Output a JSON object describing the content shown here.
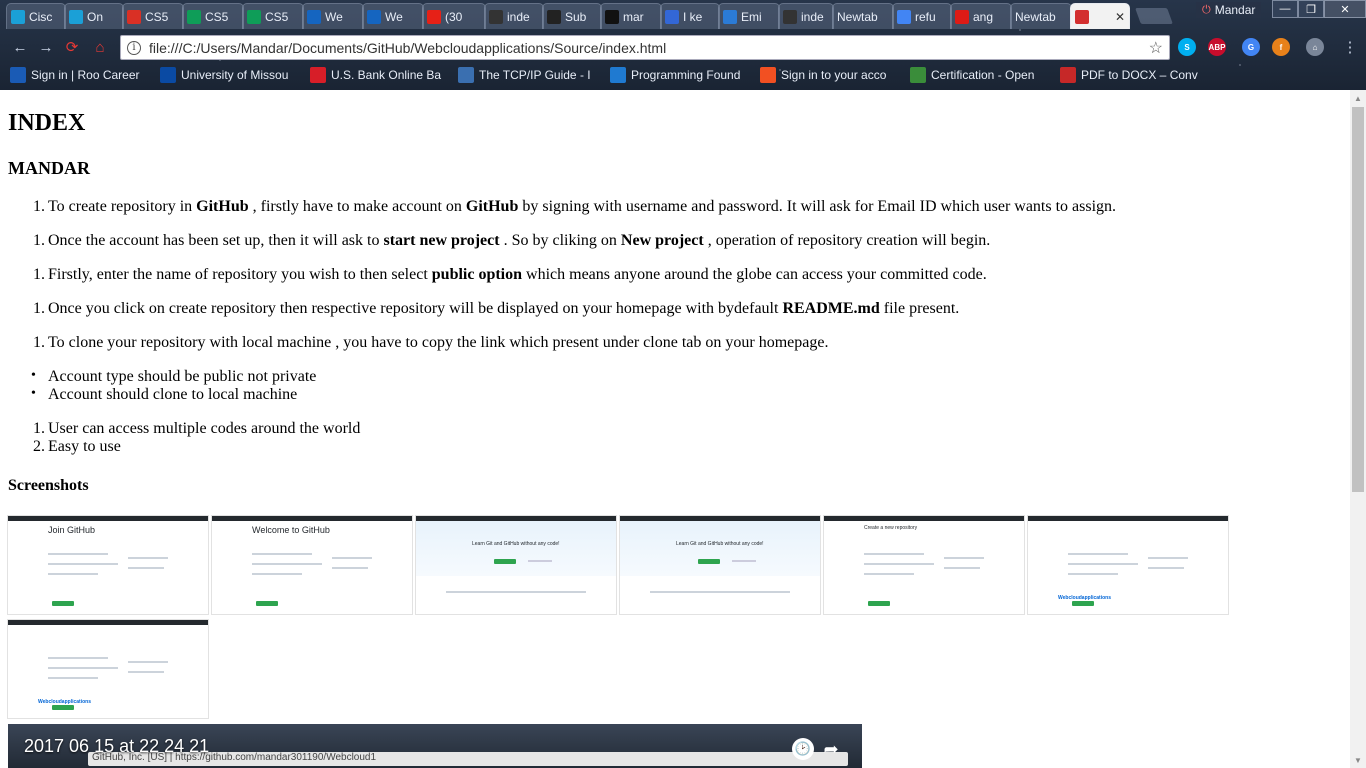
{
  "tabs": [
    {
      "label": "Cisc",
      "icon": "cisco-icon",
      "color": "#1ba0d7"
    },
    {
      "label": "On",
      "icon": "cisco-icon",
      "color": "#1ba0d7"
    },
    {
      "label": "CS5",
      "icon": "gmail-icon",
      "color": "#d93025"
    },
    {
      "label": "CS5",
      "icon": "sheets-icon",
      "color": "#0f9d58"
    },
    {
      "label": "CS5",
      "icon": "sheets-icon",
      "color": "#0f9d58"
    },
    {
      "label": "We",
      "icon": "b-icon",
      "color": "#1565c0"
    },
    {
      "label": "We",
      "icon": "b-icon",
      "color": "#1565c0"
    },
    {
      "label": "(30",
      "icon": "youtube-icon",
      "color": "#e62117"
    },
    {
      "label": "inde",
      "icon": "ws-icon",
      "color": "#333333"
    },
    {
      "label": "Sub",
      "icon": "bb-icon",
      "color": "#222222"
    },
    {
      "label": "mar",
      "icon": "github-icon",
      "color": "#111111"
    },
    {
      "label": "I ke",
      "icon": "doc-icon",
      "color": "#3367d6"
    },
    {
      "label": "Emi",
      "icon": "code-icon",
      "color": "#2b7bd6"
    },
    {
      "label": "inde",
      "icon": "ws-icon",
      "color": "#333333"
    },
    {
      "label": "Newtab",
      "icon": "",
      "color": ""
    },
    {
      "label": "refu",
      "icon": "google-icon",
      "color": "#4285f4"
    },
    {
      "label": "ang",
      "icon": "angular-icon",
      "color": "#dd1b16"
    },
    {
      "label": "Newtab",
      "icon": "",
      "color": ""
    },
    {
      "label": "",
      "icon": "pdf-icon",
      "color": "#d32f2f"
    }
  ],
  "profile": {
    "name": "Mandar"
  },
  "window_controls": {
    "minimize": "—",
    "maximize": "❐",
    "close": "✕"
  },
  "toolbar": {
    "back": "←",
    "forward": "→",
    "reload": "⟳",
    "home": "⌂",
    "url": "file:///C:/Users/Mandar/Documents/GitHub/Webcloudapplications/Source/index.html",
    "info": "i",
    "star": "☆",
    "menu": "⋮"
  },
  "extensions": [
    {
      "name": "skype-icon",
      "label": "S",
      "color": "#00aff0"
    },
    {
      "name": "adblock-icon",
      "label": "ABP",
      "color": "#c70d2c"
    },
    {
      "name": "translate-icon",
      "label": "G",
      "color": "#4285f4"
    },
    {
      "name": "flash-icon",
      "label": "f",
      "color": "#e8811a"
    },
    {
      "name": "home-ext-icon",
      "label": "⌂",
      "color": "#7a8699"
    }
  ],
  "bookmarks": [
    {
      "label": "Sign in | Roo Career",
      "icon": "roo-icon",
      "color": "#1a5bb5"
    },
    {
      "label": "University of Missou",
      "icon": "umkc-icon",
      "color": "#0a4aa3"
    },
    {
      "label": "U.S. Bank Online Ba",
      "icon": "usbank-icon",
      "color": "#d71e28"
    },
    {
      "label": "The TCP/IP Guide - I",
      "icon": "tcpip-icon",
      "color": "#3a6fb0"
    },
    {
      "label": "Programming Found",
      "icon": "w-icon",
      "color": "#1f7ad1"
    },
    {
      "label": "Sign in to your acco",
      "icon": "microsoft-icon",
      "color": "#f25022"
    },
    {
      "label": "Certification - Open",
      "icon": "cert-icon",
      "color": "#3a8d3a"
    },
    {
      "label": "PDF to DOCX – Conv",
      "icon": "pdf-docx-icon",
      "color": "#c62828"
    }
  ],
  "page": {
    "h1": "INDEX",
    "h2": "MANDAR",
    "steps": [
      {
        "num": "1.",
        "parts": [
          {
            "t": "To create repository in ",
            "b": false
          },
          {
            "t": "GitHub",
            "b": true
          },
          {
            "t": " , firstly have to make account on ",
            "b": false
          },
          {
            "t": "GitHub",
            "b": true
          },
          {
            "t": " by signing with username and password. It will ask for Email ID which user wants to assign.",
            "b": false
          }
        ]
      },
      {
        "num": "1.",
        "parts": [
          {
            "t": "Once the account has been set up, then it will ask to ",
            "b": false
          },
          {
            "t": "start new project",
            "b": true
          },
          {
            "t": " . So by cliking on ",
            "b": false
          },
          {
            "t": "New project",
            "b": true
          },
          {
            "t": " , operation of repository creation will begin.",
            "b": false
          }
        ]
      },
      {
        "num": "1.",
        "parts": [
          {
            "t": "Firstly, enter the name of repository you wish to then select ",
            "b": false
          },
          {
            "t": "public option",
            "b": true
          },
          {
            "t": " which means anyone around the globe can access your committed code.",
            "b": false
          }
        ]
      },
      {
        "num": "1.",
        "parts": [
          {
            "t": "Once you click on create repository then respective repository will be displayed on your homepage with bydefault ",
            "b": false
          },
          {
            "t": "README.md",
            "b": true
          },
          {
            "t": " file present.",
            "b": false
          }
        ]
      },
      {
        "num": "1.",
        "parts": [
          {
            "t": "To clone your repository with local machine , you have to copy the link which present under clone tab on your homepage.",
            "b": false
          }
        ]
      }
    ],
    "bullets": [
      "Account type should be public not private",
      "Account should clone to local machine"
    ],
    "advantages": [
      {
        "num": "1.",
        "text": "User can access multiple codes around the world"
      },
      {
        "num": "2.",
        "text": "Easy to use"
      }
    ],
    "screenshots_heading": "Screenshots",
    "thumbnails": [
      {
        "title": "Join GitHub"
      },
      {
        "title": "Welcome to GitHub"
      },
      {
        "title": "Learn Git and GitHub without any code!"
      },
      {
        "title": "Learn Git and GitHub without any code!"
      },
      {
        "title": "Create a new repository"
      },
      {
        "title": "Webcloudapplications"
      },
      {
        "title": "Webcloudapplications"
      }
    ]
  },
  "preview": {
    "timestamp": "2017 06 15 at 22 24 21",
    "url": "GitHub, Inc. [US] | https://github.com/mandar301190/Webcloud1"
  },
  "scrollbar": {
    "up": "▲",
    "down": "▼"
  }
}
